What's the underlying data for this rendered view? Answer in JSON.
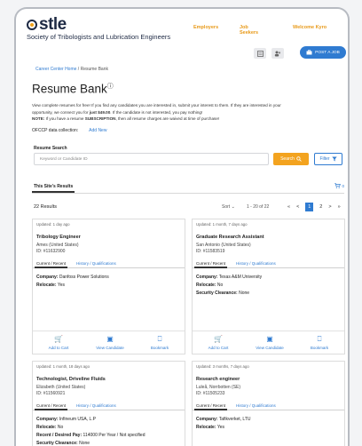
{
  "header": {
    "logo_word": "stle",
    "logo_sub": "Society of Tribologists and Lubrication Engineers",
    "nav": [
      "Employers",
      "Job Seekers",
      "Welcome Kyro"
    ],
    "post_job_label": "POST A JOB"
  },
  "breadcrumb": {
    "home": "Career Center Home",
    "sep": "/",
    "current": "Resume Bank"
  },
  "page": {
    "title": "Resume Bank",
    "title_sup": "ⓘ",
    "intro_line1": "View complete resumes for free! If you find any candidates you are interested in, submit your interest to them. If they are interested in your",
    "intro_line2a": "opportunity, we connect you for ",
    "intro_price": "just $49.00",
    "intro_line2b": ". If the candidate is not interested, you pay nothing!",
    "note_label": "NOTE:",
    "note_a": " If you have a resume ",
    "note_sub": "SUBSCRIPTION",
    "note_b": ", then all resume charges are waived at time of purchase!"
  },
  "ofccp": {
    "label": "OFCCP data collection:",
    "add_new": "Add New"
  },
  "search": {
    "label": "Resume Search",
    "placeholder": "Keyword or Candidate ID",
    "search_button": "Search",
    "filter_button": "Filter"
  },
  "tabs": {
    "active": "This Site's Results",
    "cart_count": "0"
  },
  "results": {
    "count": "22 Results",
    "sort": "Sort",
    "range": "1 - 20 of 22",
    "pages": [
      "1",
      "2"
    ],
    "current_page": "1"
  },
  "card_tabs": {
    "current": "Current / Recent",
    "history": "History / Qualifications"
  },
  "card_actions": {
    "add_to_cart": "Add to Cart",
    "view": "View Candidate",
    "bookmark": "Bookmark"
  },
  "cards": [
    {
      "updated": "Updated: 1 day ago",
      "job": "Tribology Engineer",
      "location": "Ames (United States)",
      "id": "ID: #11632900",
      "company_label": "Company:",
      "company": " Danfoss Power Solutions",
      "relocate_label": "Relocate:",
      "relocate": " Yes"
    },
    {
      "updated": "Updated: 1 month, 7 days ago",
      "job": "Graduate Research Assistant",
      "location": "San Antonio (United States)",
      "id": "ID: #11583519",
      "company_label": "Company:",
      "company": " Texas A&M University",
      "relocate_label": "Relocate:",
      "relocate": " No",
      "clearance_label": "Security Clearance:",
      "clearance": " None"
    },
    {
      "updated": "Updated: 1 month, 18 days ago",
      "job": "Technologist, Driveline Fluids",
      "location": "Elizabeth (United States)",
      "id": "ID: #11560921",
      "company_label": "Company:",
      "company": " Infineum USA, L.P",
      "relocate_label": "Relocate:",
      "relocate": " No",
      "pay_label": "Recent / Desired Pay:",
      "pay": " 114000 Per Year / Not specified",
      "clearance_label": "Security Clearance:",
      "clearance": " None"
    },
    {
      "updated": "Updated: 3 months, 7 days ago",
      "job": "Research engineer",
      "location": "Luleå, Norrbotten (SE)",
      "id": "ID: #11505233",
      "company_label": "Company:",
      "company": " Tafikverket, LTU",
      "relocate_label": "Relocate:",
      "relocate": " Yes"
    }
  ],
  "colors": {
    "accent_blue": "#2f7bd1",
    "accent_orange": "#f3a31f",
    "brand_navy": "#1e2a44"
  }
}
